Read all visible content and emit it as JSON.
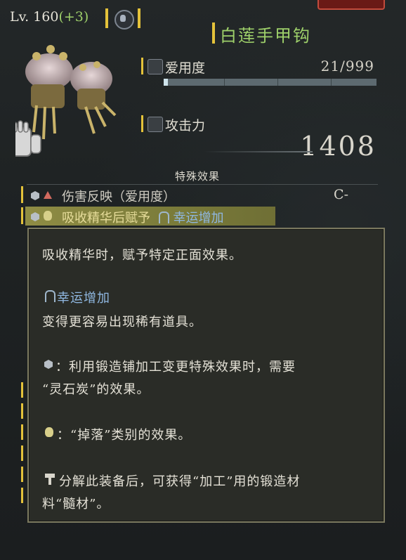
{
  "header": {
    "level_text": "Lv. 160",
    "level_bonus": "(+3)",
    "item_name": "白莲手甲钩"
  },
  "stats": {
    "durability_label": "爱用度",
    "durability_value": "21/999",
    "durability_progress": 0.021,
    "attack_label": "攻击力",
    "attack_value": "1408"
  },
  "effects": {
    "section_title": "特殊效果",
    "rows": [
      {
        "text": "伤害反映（爱用度）",
        "grade": "C-",
        "selected": false
      },
      {
        "text": "吸收精华后赋予",
        "suffix": "幸运增加",
        "selected": true
      }
    ]
  },
  "tooltip": {
    "line1": "吸收精华时，赋予特定正面效果。",
    "effect_name": "幸运增加",
    "line2": "变得更容易出现稀有道具。",
    "line3": "：利用锻造铺加工变更特殊效果时，需要",
    "line4": "“灵石炭”的效果。",
    "line5": "：“掉落”类别的效果。",
    "line6": "分解此装备后，可获得“加工”用的锻造材",
    "line7": "料“髓材”。"
  },
  "colors": {
    "accent_gold": "#e4c23a",
    "item_name_green": "#9ed06a",
    "effect_blue": "#8fb7e0",
    "selected_row": "#8f8c44"
  },
  "icons": [
    "clan-emblem-icon",
    "durability-icon",
    "attack-icon",
    "hex-forge-icon",
    "red-triangle-icon",
    "drop-bag-icon",
    "luck-arch-icon",
    "hammer-icon"
  ]
}
